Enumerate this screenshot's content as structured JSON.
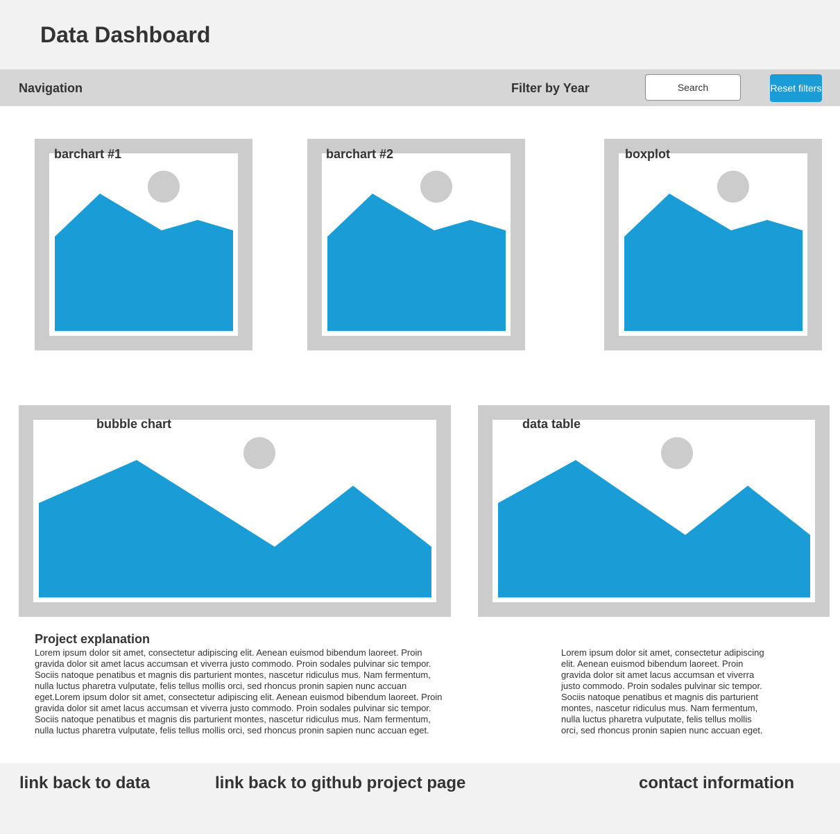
{
  "header": {
    "title": "Data Dashboard"
  },
  "nav": {
    "navigation_label": "Navigation",
    "filter_label": "Filter by Year",
    "search_label": "Search",
    "reset_label": "Reset filters"
  },
  "cards": [
    {
      "title": "barchart #1"
    },
    {
      "title": "barchart #2"
    },
    {
      "title": "boxplot"
    },
    {
      "title": "bubble chart"
    },
    {
      "title": "data table"
    }
  ],
  "explanation": {
    "heading": "Project explanation",
    "left_lines": [
      "Lorem ipsum dolor sit amet, consectetur adipiscing elit. Aenean euismod bibendum laoreet. Proin",
      "gravida dolor sit amet lacus accumsan et viverra justo commodo. Proin sodales pulvinar sic tempor.",
      "Sociis natoque penatibus et magnis dis parturient montes, nascetur ridiculus mus. Nam fermentum,",
      "nulla luctus pharetra vulputate, felis tellus mollis orci, sed rhoncus pronin sapien nunc accuan",
      "eget.Lorem ipsum dolor sit amet, consectetur adipiscing elit. Aenean euismod bibendum laoreet. Proin",
      "gravida dolor sit amet lacus accumsan et viverra justo commodo. Proin sodales pulvinar sic tempor.",
      "Sociis natoque penatibus et magnis dis parturient montes, nascetur ridiculus mus. Nam fermentum,",
      "nulla luctus pharetra vulputate, felis tellus mollis orci, sed rhoncus pronin sapien nunc accuan eget."
    ],
    "right_lines": [
      "Lorem ipsum dolor sit amet, consectetur adipiscing",
      "elit. Aenean euismod bibendum laoreet. Proin",
      "gravida dolor sit amet lacus accumsan et viverra",
      "justo commodo. Proin sodales pulvinar sic tempor.",
      "Sociis natoque penatibus et magnis dis parturient",
      "montes, nascetur ridiculus mus. Nam fermentum,",
      "nulla luctus pharetra vulputate, felis tellus mollis",
      "orci, sed rhoncus pronin sapien nunc accuan eget."
    ]
  },
  "footer": {
    "data_link": "link back to data",
    "github_link": "link back to github project page",
    "contact": "contact information"
  },
  "colors": {
    "accent": "#1a9cd6",
    "frame": "#cccccc",
    "header_bg": "#f2f2f2",
    "nav_bg": "#d6d6d6",
    "text": "#333333"
  },
  "icons": {
    "placeholder": "image-placeholder-icon"
  }
}
